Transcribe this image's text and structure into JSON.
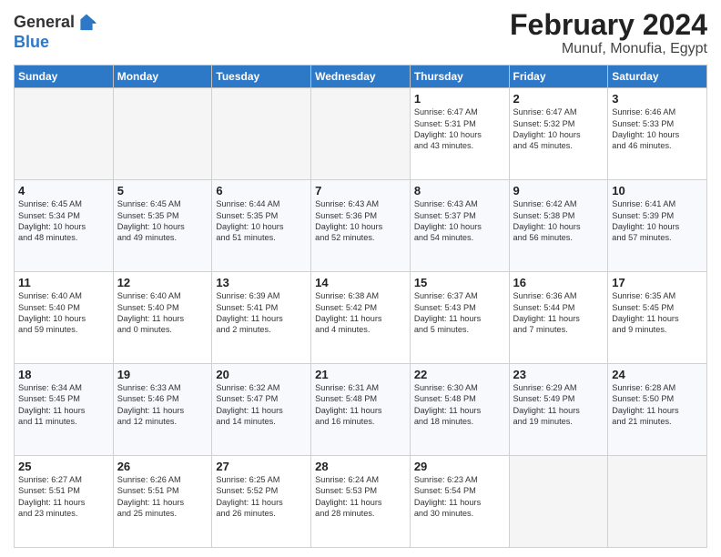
{
  "logo": {
    "line1": "General",
    "line2": "Blue"
  },
  "title": "February 2024",
  "subtitle": "Munuf, Monufia, Egypt",
  "days_of_week": [
    "Sunday",
    "Monday",
    "Tuesday",
    "Wednesday",
    "Thursday",
    "Friday",
    "Saturday"
  ],
  "weeks": [
    [
      {
        "day": "",
        "content": ""
      },
      {
        "day": "",
        "content": ""
      },
      {
        "day": "",
        "content": ""
      },
      {
        "day": "",
        "content": ""
      },
      {
        "day": "1",
        "content": "Sunrise: 6:47 AM\nSunset: 5:31 PM\nDaylight: 10 hours\nand 43 minutes."
      },
      {
        "day": "2",
        "content": "Sunrise: 6:47 AM\nSunset: 5:32 PM\nDaylight: 10 hours\nand 45 minutes."
      },
      {
        "day": "3",
        "content": "Sunrise: 6:46 AM\nSunset: 5:33 PM\nDaylight: 10 hours\nand 46 minutes."
      }
    ],
    [
      {
        "day": "4",
        "content": "Sunrise: 6:45 AM\nSunset: 5:34 PM\nDaylight: 10 hours\nand 48 minutes."
      },
      {
        "day": "5",
        "content": "Sunrise: 6:45 AM\nSunset: 5:35 PM\nDaylight: 10 hours\nand 49 minutes."
      },
      {
        "day": "6",
        "content": "Sunrise: 6:44 AM\nSunset: 5:35 PM\nDaylight: 10 hours\nand 51 minutes."
      },
      {
        "day": "7",
        "content": "Sunrise: 6:43 AM\nSunset: 5:36 PM\nDaylight: 10 hours\nand 52 minutes."
      },
      {
        "day": "8",
        "content": "Sunrise: 6:43 AM\nSunset: 5:37 PM\nDaylight: 10 hours\nand 54 minutes."
      },
      {
        "day": "9",
        "content": "Sunrise: 6:42 AM\nSunset: 5:38 PM\nDaylight: 10 hours\nand 56 minutes."
      },
      {
        "day": "10",
        "content": "Sunrise: 6:41 AM\nSunset: 5:39 PM\nDaylight: 10 hours\nand 57 minutes."
      }
    ],
    [
      {
        "day": "11",
        "content": "Sunrise: 6:40 AM\nSunset: 5:40 PM\nDaylight: 10 hours\nand 59 minutes."
      },
      {
        "day": "12",
        "content": "Sunrise: 6:40 AM\nSunset: 5:40 PM\nDaylight: 11 hours\nand 0 minutes."
      },
      {
        "day": "13",
        "content": "Sunrise: 6:39 AM\nSunset: 5:41 PM\nDaylight: 11 hours\nand 2 minutes."
      },
      {
        "day": "14",
        "content": "Sunrise: 6:38 AM\nSunset: 5:42 PM\nDaylight: 11 hours\nand 4 minutes."
      },
      {
        "day": "15",
        "content": "Sunrise: 6:37 AM\nSunset: 5:43 PM\nDaylight: 11 hours\nand 5 minutes."
      },
      {
        "day": "16",
        "content": "Sunrise: 6:36 AM\nSunset: 5:44 PM\nDaylight: 11 hours\nand 7 minutes."
      },
      {
        "day": "17",
        "content": "Sunrise: 6:35 AM\nSunset: 5:45 PM\nDaylight: 11 hours\nand 9 minutes."
      }
    ],
    [
      {
        "day": "18",
        "content": "Sunrise: 6:34 AM\nSunset: 5:45 PM\nDaylight: 11 hours\nand 11 minutes."
      },
      {
        "day": "19",
        "content": "Sunrise: 6:33 AM\nSunset: 5:46 PM\nDaylight: 11 hours\nand 12 minutes."
      },
      {
        "day": "20",
        "content": "Sunrise: 6:32 AM\nSunset: 5:47 PM\nDaylight: 11 hours\nand 14 minutes."
      },
      {
        "day": "21",
        "content": "Sunrise: 6:31 AM\nSunset: 5:48 PM\nDaylight: 11 hours\nand 16 minutes."
      },
      {
        "day": "22",
        "content": "Sunrise: 6:30 AM\nSunset: 5:48 PM\nDaylight: 11 hours\nand 18 minutes."
      },
      {
        "day": "23",
        "content": "Sunrise: 6:29 AM\nSunset: 5:49 PM\nDaylight: 11 hours\nand 19 minutes."
      },
      {
        "day": "24",
        "content": "Sunrise: 6:28 AM\nSunset: 5:50 PM\nDaylight: 11 hours\nand 21 minutes."
      }
    ],
    [
      {
        "day": "25",
        "content": "Sunrise: 6:27 AM\nSunset: 5:51 PM\nDaylight: 11 hours\nand 23 minutes."
      },
      {
        "day": "26",
        "content": "Sunrise: 6:26 AM\nSunset: 5:51 PM\nDaylight: 11 hours\nand 25 minutes."
      },
      {
        "day": "27",
        "content": "Sunrise: 6:25 AM\nSunset: 5:52 PM\nDaylight: 11 hours\nand 26 minutes."
      },
      {
        "day": "28",
        "content": "Sunrise: 6:24 AM\nSunset: 5:53 PM\nDaylight: 11 hours\nand 28 minutes."
      },
      {
        "day": "29",
        "content": "Sunrise: 6:23 AM\nSunset: 5:54 PM\nDaylight: 11 hours\nand 30 minutes."
      },
      {
        "day": "",
        "content": ""
      },
      {
        "day": "",
        "content": ""
      }
    ]
  ]
}
